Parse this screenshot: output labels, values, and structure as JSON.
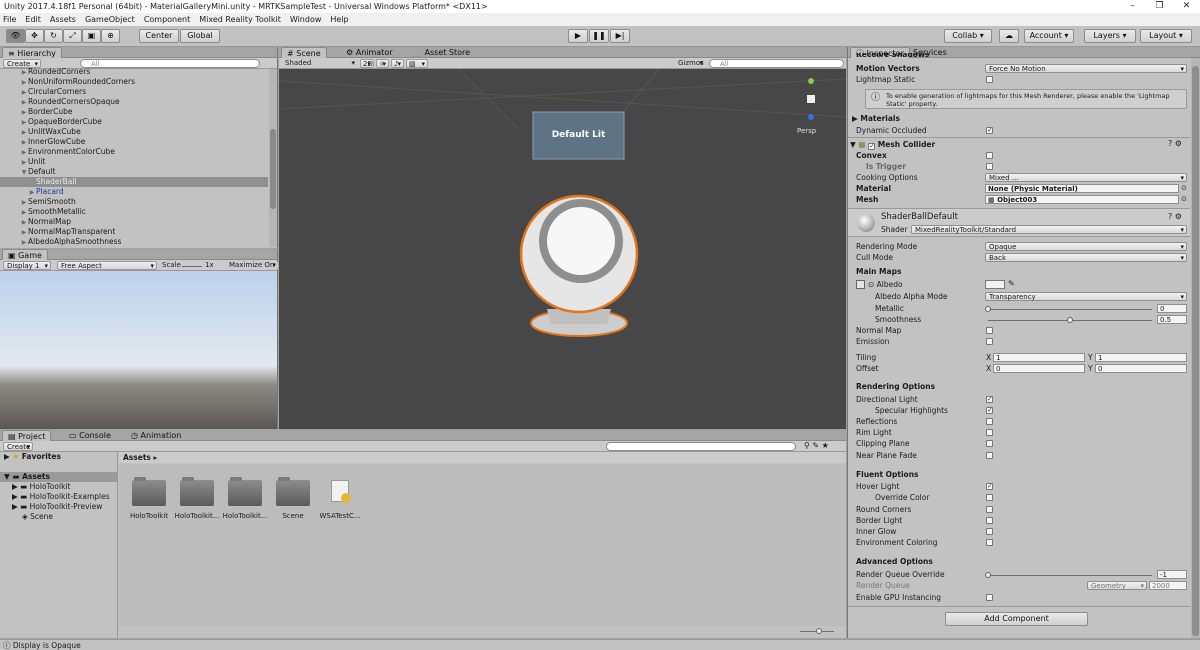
{
  "window": {
    "title": "Unity 2017.4.18f1 Personal (64bit) - MaterialGalleryMini.unity - MRTKSampleTest - Universal Windows Platform* <DX11>"
  },
  "menu": [
    "File",
    "Edit",
    "Assets",
    "GameObject",
    "Component",
    "Mixed Reality Toolkit",
    "Window",
    "Help"
  ],
  "toolbar": {
    "center": "Center",
    "global": "Global",
    "collab": "Collab",
    "account": "Account",
    "layers": "Layers",
    "layout": "Layout"
  },
  "hierarchy": {
    "tab": "Hierarchy",
    "create": "Create",
    "search_placeholder": "All",
    "items": [
      "RoundedCorners",
      "NonUniformRoundedCorners",
      "CircularCorners",
      "RoundedCornersOpaque",
      "BorderCube",
      "OpaqueBorderCube",
      "UnlitWaxCube",
      "InnerGlowCube",
      "EnvironmentColorCube",
      "Unlit",
      "Default",
      "ShaderBall",
      "Placard",
      "SemiSmooth",
      "SmoothMetallic",
      "NormalMap",
      "NormalMapTransparent",
      "AlbedoAlphaSmoothness"
    ]
  },
  "scene": {
    "tabs": [
      "Scene",
      "Animator",
      "Asset Store"
    ],
    "shaded": "Shaded",
    "mode2d": "2D",
    "gizmos": "Gizmos",
    "search_placeholder": "All",
    "placard": "Default Lit",
    "persp": "Persp"
  },
  "game": {
    "tab": "Game",
    "display": "Display 1",
    "aspect": "Free Aspect",
    "scale_label": "Scale",
    "scale_value": "1x",
    "maximize": "Maximize On Pl"
  },
  "project": {
    "tabs": [
      "Project",
      "Console",
      "Animation"
    ],
    "create": "Create",
    "favorites": "Favorites",
    "assets_root": "Assets",
    "tree": [
      "HoloToolkit",
      "HoloToolkit-Examples",
      "HoloToolkit-Preview",
      "Scene"
    ],
    "breadcrumb": "Assets",
    "items": [
      "HoloToolkit",
      "HoloToolkit...",
      "HoloToolkit...",
      "Scene",
      "WSATestC..."
    ]
  },
  "inspector": {
    "tabs": [
      "Inspector",
      "Services"
    ],
    "receive_shadows": "Receive Shadows",
    "motion_vectors": "Motion Vectors",
    "motion_vectors_value": "Force No Motion",
    "lightmap_static": "Lightmap Static",
    "info": "To enable generation of lightmaps for this Mesh Renderer, please enable the 'Lightmap Static' property.",
    "materials": "Materials",
    "dynamic_occluded": "Dynamic Occluded",
    "mesh_collider": "Mesh Collider",
    "convex": "Convex",
    "is_trigger": "Is Trigger",
    "cooking": "Cooking Options",
    "cooking_value": "Mixed ...",
    "material": "Material",
    "material_value": "None (Physic Material)",
    "mesh": "Mesh",
    "mesh_value": "Object003",
    "mat_name": "ShaderBallDefault",
    "shader_label": "Shader",
    "shader_value": "MixedRealityToolkit/Standard",
    "rendering_mode": "Rendering Mode",
    "rendering_mode_value": "Opaque",
    "cull_mode": "Cull Mode",
    "cull_mode_value": "Back",
    "main_maps": "Main Maps",
    "albedo": "Albedo",
    "albedo_alpha_mode": "Albedo Alpha Mode",
    "albedo_alpha_value": "Transparency",
    "metallic": "Metallic",
    "metallic_value": "0",
    "smoothness": "Smoothness",
    "smoothness_value": "0.5",
    "normal_map": "Normal Map",
    "emission": "Emission",
    "tiling": "Tiling",
    "offset": "Offset",
    "x": "X",
    "y": "Y",
    "tiling_x": "1",
    "tiling_y": "1",
    "offset_x": "0",
    "offset_y": "0",
    "rendering_options": "Rendering Options",
    "directional_light": "Directional Light",
    "specular_highlights": "Specular Highlights",
    "reflections": "Reflections",
    "rim_light": "Rim Light",
    "clipping_plane": "Clipping Plane",
    "near_plane_fade": "Near Plane Fade",
    "fluent_options": "Fluent Options",
    "hover_light": "Hover Light",
    "override_color": "Override Color",
    "round_corners": "Round Corners",
    "border_light": "Border Light",
    "inner_glow": "Inner Glow",
    "environment_coloring": "Environment Coloring",
    "advanced_options": "Advanced Options",
    "render_queue_override": "Render Queue Override",
    "render_queue_override_value": "-1",
    "render_queue": "Render Queue",
    "render_queue_mode": "Geometry",
    "render_queue_value": "2000",
    "gpu_instancing": "Enable GPU Instancing",
    "add_component": "Add Component"
  },
  "status": {
    "text": "Display is Opaque"
  }
}
